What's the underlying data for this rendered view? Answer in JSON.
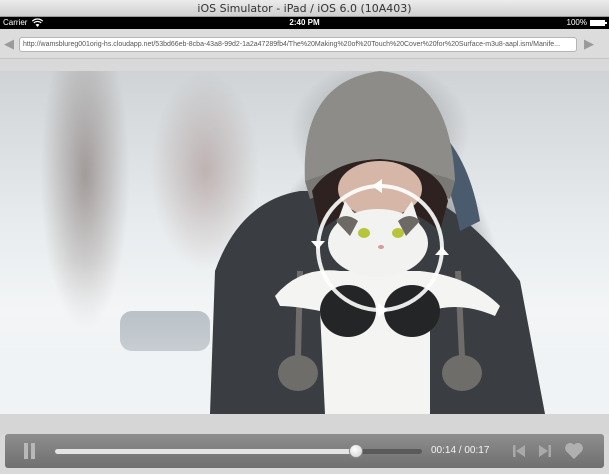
{
  "window": {
    "title": "iOS Simulator - iPad / iOS 6.0 (10A403)"
  },
  "status_bar": {
    "carrier": "Carrier",
    "time": "2:40 PM",
    "battery": "100%"
  },
  "browser": {
    "url": "http://wamsblureg001orig-hs.cloudapp.net/53bd66eb-8cba-43a8-99d2-1a2a47289fb4/The%20Making%20of%20Touch%20Cover%20for%20Surface-m3u8-aapl.ism/Manife..."
  },
  "player": {
    "elapsed": "00:14",
    "duration": "00:17",
    "time_display": "00:14 / 00:17",
    "progress": 0.82,
    "pause_icon": "pause-icon",
    "prev_icon": "skip-back-icon",
    "next_icon": "skip-forward-icon",
    "favorite_icon": "heart-icon",
    "overlay_icon": "rotate-circle-arrows-icon"
  },
  "colors": {
    "control_bar": "#7f7f7f",
    "progress_fill": "#e4e4e4",
    "status_bar": "#000000"
  }
}
